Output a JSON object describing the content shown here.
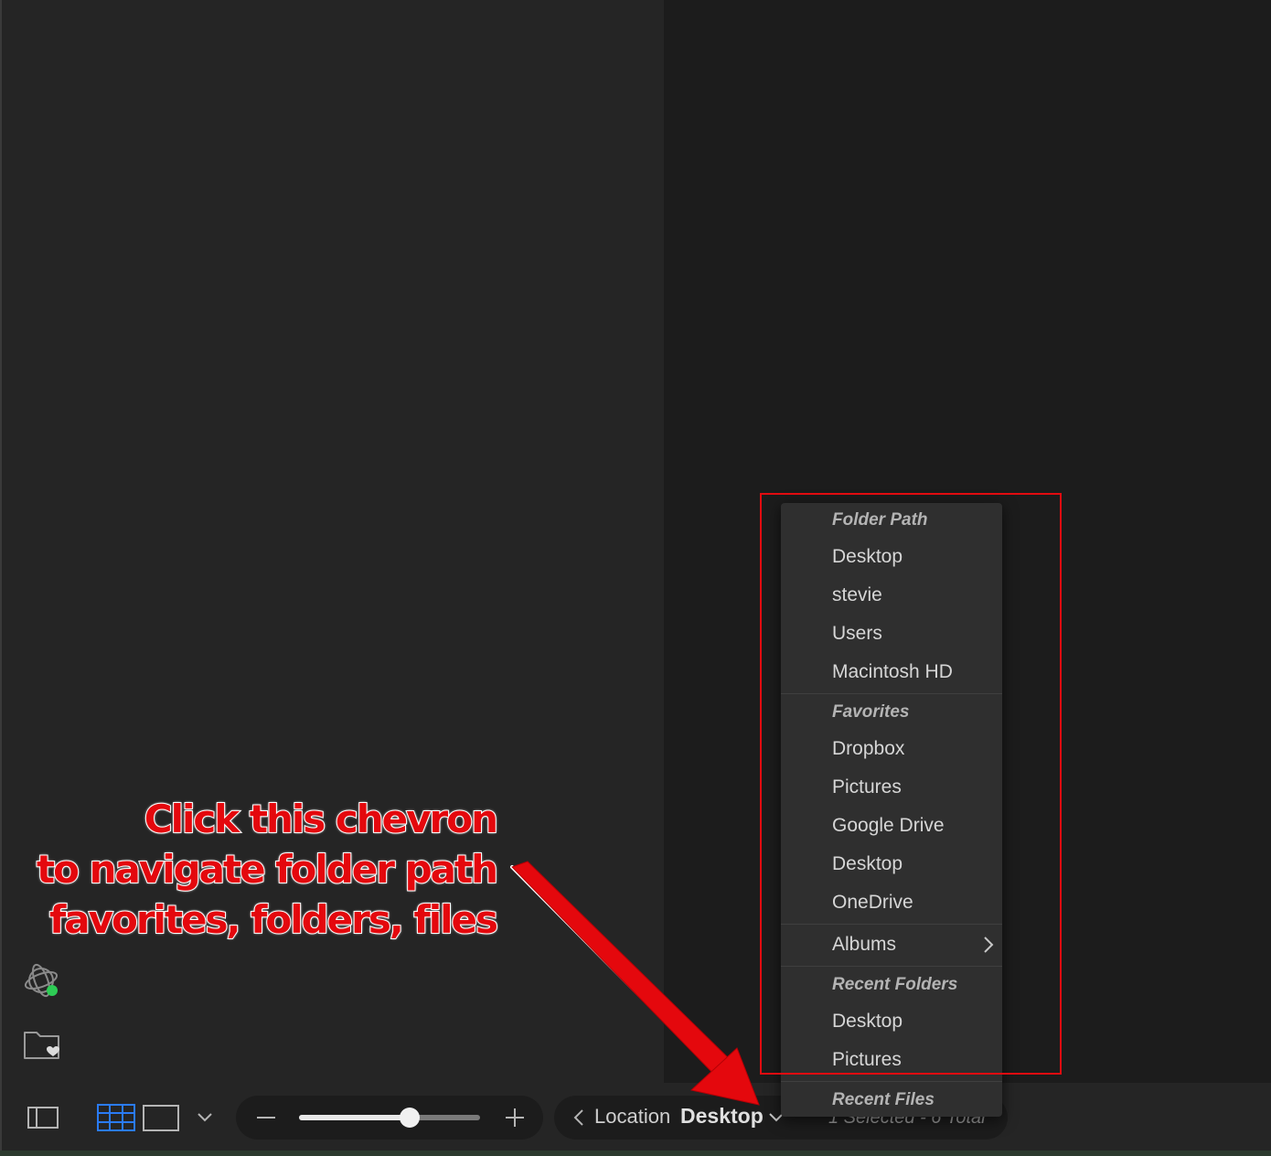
{
  "toolbar": {
    "location_label": "Location",
    "location_value": "Desktop",
    "status": "1 Selected - 6 Total",
    "zoom_level": 0.61
  },
  "menu": {
    "sections": [
      {
        "header": "Folder Path",
        "items": [
          "Desktop",
          "stevie",
          "Users",
          "Macintosh HD"
        ]
      },
      {
        "header": "Favorites",
        "items": [
          "Dropbox",
          "Pictures",
          "Google Drive",
          "Desktop",
          "OneDrive"
        ]
      },
      {
        "submenu": "Albums"
      },
      {
        "header": "Recent Folders",
        "items": [
          "Desktop",
          "Pictures"
        ]
      },
      {
        "header": "Recent Files"
      }
    ]
  },
  "annotation": {
    "lines": [
      "Click this chevron",
      "to navigate folder path",
      "favorites, folders, files"
    ],
    "color": "#e4080d"
  },
  "icons": {
    "sidebar": [
      "connect-icon",
      "favorite-folder-icon"
    ],
    "toolbar": [
      "sidebar-toggle-icon",
      "grid-view-icon",
      "single-view-icon",
      "view-options-chevron-icon",
      "zoom-out-icon",
      "zoom-in-icon",
      "back-chevron-icon",
      "location-chevron-icon"
    ]
  },
  "colors": {
    "accent_blue": "#2a7bf6",
    "status_green": "#2ecc55",
    "highlight_red": "#e10b10"
  }
}
